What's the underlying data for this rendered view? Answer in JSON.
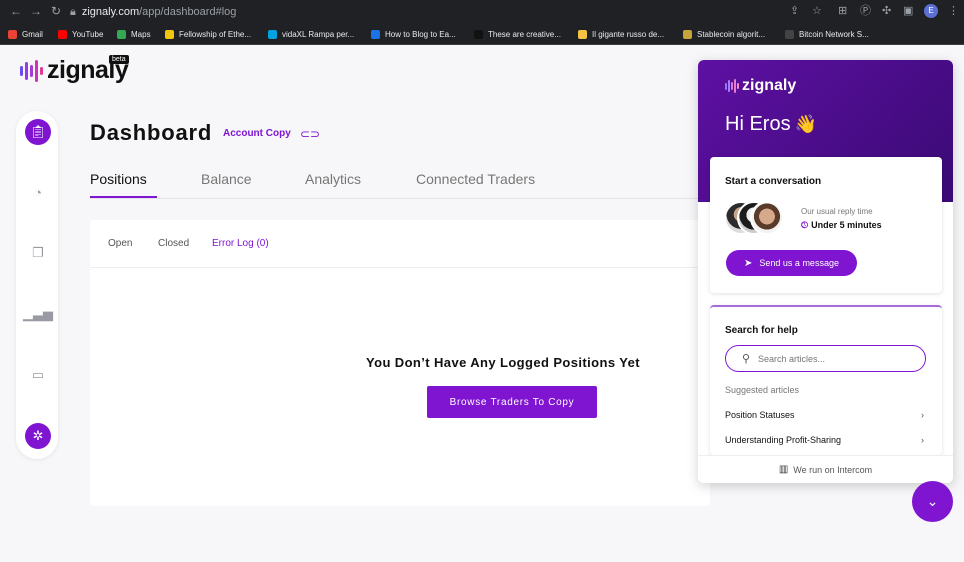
{
  "browser": {
    "url_host": "zignaly.com",
    "url_path": "/app/dashboard#log",
    "avatar_letter": "E"
  },
  "bookmarks": [
    {
      "label": "Gmail",
      "color": "#ea4335"
    },
    {
      "label": "YouTube",
      "color": "#ff0000"
    },
    {
      "label": "Maps",
      "color": "#34a853"
    },
    {
      "label": "Fellowship of Ethe...",
      "color": "#f1c40f"
    },
    {
      "label": "vidaXL Rampa per...",
      "color": "#00a3e0"
    },
    {
      "label": "How to Blog to Ea...",
      "color": "#1a73e8"
    },
    {
      "label": "These are creative...",
      "color": "#111111"
    },
    {
      "label": "Il gigante russo de...",
      "color": "#f6c244"
    },
    {
      "label": "Stablecoin algorit...",
      "color": "#c8a23c"
    },
    {
      "label": "Bitcoin Network S...",
      "color": "#444444"
    }
  ],
  "app": {
    "logo_text": "zignaly",
    "beta_label": "beta",
    "title": "Dashboard",
    "account_label": "Account Copy",
    "tabs": [
      "Positions",
      "Balance",
      "Analytics",
      "Connected Traders"
    ],
    "subtabs": [
      "Open",
      "Closed",
      "Error Log (0)"
    ],
    "empty_message": "You Don’t Have Any Logged Positions Yet",
    "browse_button": "Browse Traders To Copy"
  },
  "intercom": {
    "logo_text": "zignaly",
    "greeting": "Hi Eros",
    "wave": "👋",
    "conversation_title": "Start a conversation",
    "reply_label": "Our usual reply time",
    "reply_value": "Under 5 minutes",
    "send_button": "Send us a message",
    "help_title": "Search for help",
    "search_placeholder": "Search articles...",
    "suggested_label": "Suggested articles",
    "articles": [
      "Position Statuses",
      "Understanding Profit-Sharing"
    ],
    "footer": "We run on Intercom"
  },
  "colors": {
    "accent": "#7f14d1",
    "header_dark": "#3a0a74"
  }
}
